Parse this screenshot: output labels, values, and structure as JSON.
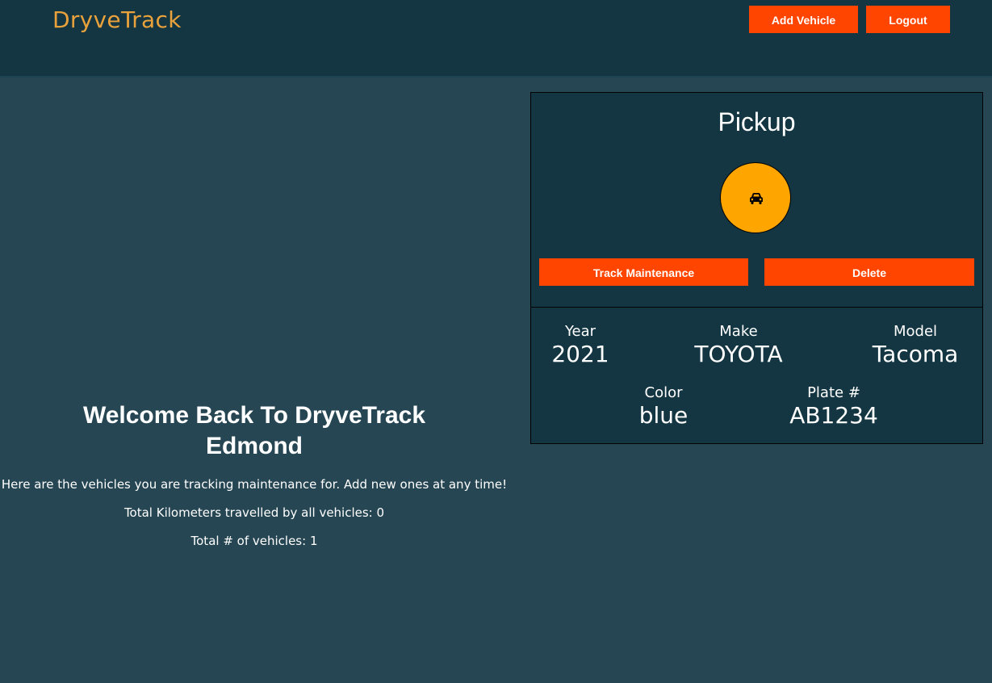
{
  "header": {
    "brand": "DryveTrack",
    "add_vehicle_label": "Add Vehicle",
    "logout_label": "Logout"
  },
  "welcome": {
    "title_line1": "Welcome Back To DryveTrack",
    "title_line2": "Edmond",
    "intro": "Here are the vehicles you are tracking maintenance for. Add new ones at any time!",
    "total_km": "Total Kilometers travelled by all vehicles: 0",
    "total_count": "Total # of vehicles: 1"
  },
  "vehicle": {
    "name": "Pickup",
    "icon": "car-icon",
    "track_label": "Track Maintenance",
    "delete_label": "Delete",
    "details": {
      "year_label": "Year",
      "year": "2021",
      "make_label": "Make",
      "make": "TOYOTA",
      "model_label": "Model",
      "model": "Tacoma",
      "color_label": "Color",
      "color": "blue",
      "plate_label": "Plate #",
      "plate": "AB1234"
    }
  },
  "colors": {
    "background": "#264653",
    "header": "#143642",
    "brand": "#e9a23b",
    "button": "#ff4500",
    "avatar": "#ffa500"
  }
}
